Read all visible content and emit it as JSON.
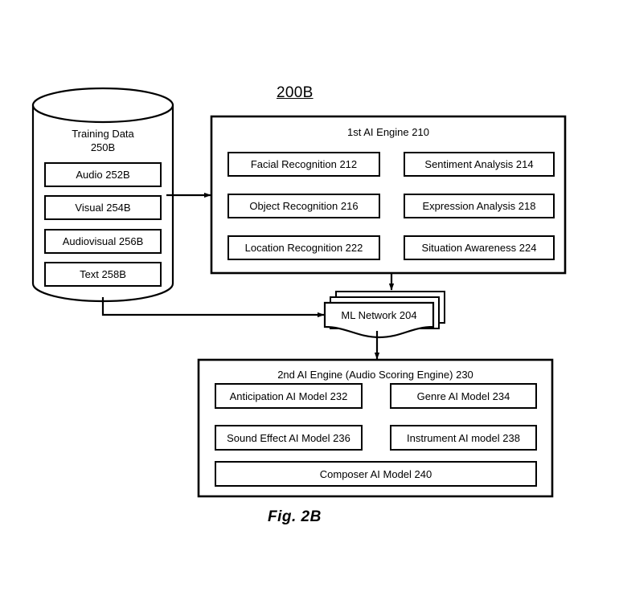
{
  "figure": {
    "diagram_id": "200B",
    "caption": "Fig. 2B",
    "background_color": "#ffffff",
    "stroke_color": "#000000"
  },
  "database": {
    "name": "database-cylinder",
    "title": "Training Data",
    "ref": "250B",
    "items": [
      {
        "label": "Audio",
        "ref": "252B"
      },
      {
        "label": "Visual",
        "ref": "254B"
      },
      {
        "label": "Audiovisual",
        "ref": "256B"
      },
      {
        "label": "Text",
        "ref": "258B"
      }
    ]
  },
  "first_engine": {
    "title": "1st AI Engine",
    "ref": "210",
    "modules": [
      {
        "label": "Facial Recognition",
        "ref": "212"
      },
      {
        "label": "Sentiment Analysis",
        "ref": "214"
      },
      {
        "label": "Object Recognition",
        "ref": "216"
      },
      {
        "label": "Expression Analysis",
        "ref": "218"
      },
      {
        "label": "Location Recognition",
        "ref": "222"
      },
      {
        "label": "Situation Awareness",
        "ref": "224"
      }
    ]
  },
  "ml_network": {
    "label": "ML Network",
    "ref": "204"
  },
  "second_engine": {
    "title": "2nd AI Engine (Audio Scoring Engine)",
    "ref": "230",
    "modules": [
      {
        "label": "Anticipation AI Model",
        "ref": "232"
      },
      {
        "label": "Genre AI Model",
        "ref": "234"
      },
      {
        "label": "Sound Effect AI Model",
        "ref": "236"
      },
      {
        "label": "Instrument AI model",
        "ref": "238"
      },
      {
        "label": "Composer AI Model",
        "ref": "240"
      }
    ]
  },
  "connectors": [
    {
      "name": "training-data-to-first-engine",
      "from": "database",
      "to": "first_engine"
    },
    {
      "name": "training-data-to-ml-network",
      "from": "database",
      "to": "ml_network"
    },
    {
      "name": "first-engine-to-ml-network",
      "from": "first_engine",
      "to": "ml_network"
    },
    {
      "name": "ml-network-to-second-engine",
      "from": "ml_network",
      "to": "second_engine"
    }
  ]
}
